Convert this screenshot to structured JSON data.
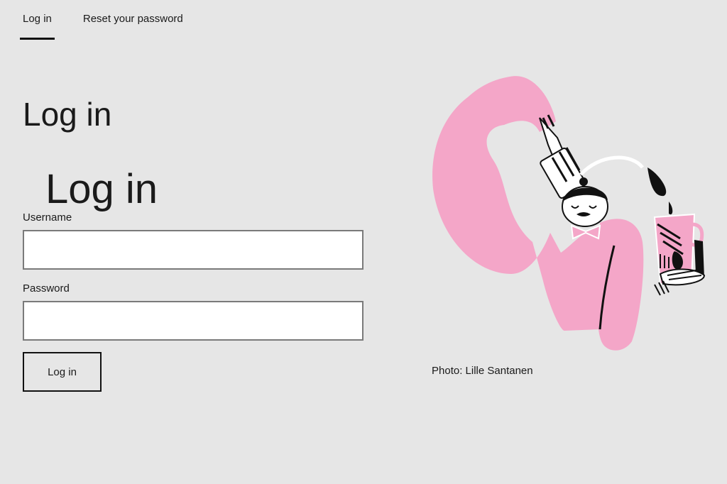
{
  "tabs": [
    {
      "label": "Log in",
      "active": true
    },
    {
      "label": "Reset your password",
      "active": false
    }
  ],
  "page_heading": "Log in",
  "form": {
    "heading": "Log in",
    "username_label": "Username",
    "username_value": "",
    "password_label": "Password",
    "password_value": "",
    "submit_label": "Log in"
  },
  "illustration": {
    "icon": "coffee-person-illustration",
    "accent_color": "#f4a6c8"
  },
  "caption": "Photo: Lille Santanen"
}
